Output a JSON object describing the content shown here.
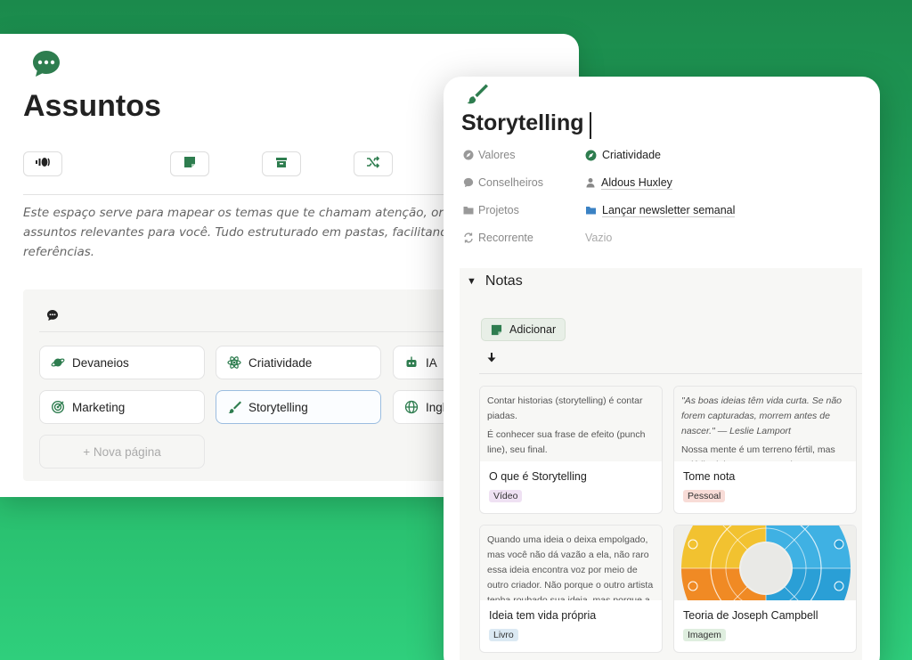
{
  "left_window": {
    "title": "Assuntos",
    "title_icon": "chat-bubble-icon",
    "toolbar": [
      "podcast-icon",
      "note-icon",
      "archive-icon",
      "shuffle-icon"
    ],
    "description": "Este espaço serve para mapear os temas que te chamam atenção, organizando por assuntos relevantes para você. Tudo estruturado em pastas, facilitando o a ideias e referências.",
    "gallery": {
      "icon": "chat-bubble-icon",
      "items": [
        {
          "label": "Devaneios",
          "icon": "planet-icon"
        },
        {
          "label": "Criatividade",
          "icon": "atom-icon"
        },
        {
          "label": "IA",
          "icon": "robot-icon"
        },
        {
          "label": "Marketing",
          "icon": "target-icon"
        },
        {
          "label": "Storytelling",
          "icon": "brush-icon"
        },
        {
          "label": "Ingl",
          "icon": "globe-icon"
        }
      ],
      "new_page": "+ Nova página"
    }
  },
  "right_window": {
    "title": "Storytelling",
    "title_icon": "brush-icon",
    "properties": [
      {
        "label": "Valores",
        "value": "Criatividade",
        "icon": "compass-icon"
      },
      {
        "label": "Conselheiros",
        "value": "Aldous Huxley",
        "icon": "person-icon"
      },
      {
        "label": "Projetos",
        "value": "Lançar newsletter semanal",
        "icon": "folder-icon"
      },
      {
        "label": "Recorrente",
        "value": "Vazio",
        "icon": "repeat-icon"
      }
    ],
    "notes": {
      "heading": "Notas",
      "add_label": "Adicionar",
      "cards": [
        {
          "title": "O que é Storytelling",
          "tag": "Vídeo",
          "tag_color": "#efe1f3",
          "preview": [
            "Contar historias (storytelling) é contar piadas.",
            "É conhecer sua frase de efeito (punch line), seu final."
          ]
        },
        {
          "title": "Tome nota",
          "tag": "Pessoal",
          "tag_color": "#f8dcd7",
          "preview": [
            "\"As boas ideias têm vida curta. Se não forem capturadas, morrem antes de nascer.\" — Leslie Lamport",
            "Nossa mente é um terreno fértil, mas volátil. Ideias surgem a todo momento"
          ]
        },
        {
          "title": "Ideia tem vida própria",
          "tag": "Livro",
          "tag_color": "#dbe9f3",
          "preview": [
            "Quando uma ideia o deixa empolgado, mas você não dá vazão a ela, não raro essa ideia encontra voz por meio de outro criador. Não porque o outro artista tenha roubado sua ideia, mas porque a hora da"
          ]
        },
        {
          "title": "Teoria de Joseph Campbell",
          "tag": "Imagem",
          "tag_color": "#dfeedf",
          "preview": []
        }
      ]
    }
  },
  "colors": {
    "accent_green": "#2e7d4f",
    "folder_blue": "#3b82c4"
  }
}
